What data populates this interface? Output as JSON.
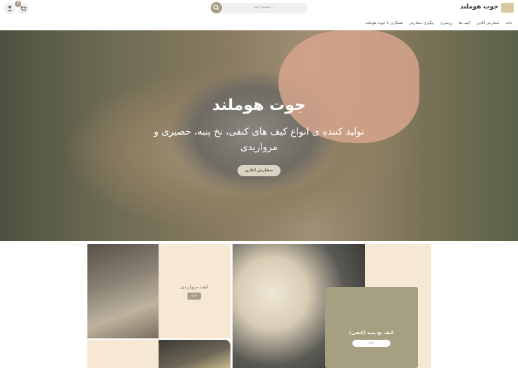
{
  "header": {
    "brand": "جوت هوملند",
    "search_placeholder": "جستجو کنید...",
    "cart_count": "0",
    "nav": [
      "خانه",
      "سفارش آنلاین",
      "کیف ها",
      "روسری",
      "پیگیری سفارش",
      "همکاری با جوت هوملند"
    ]
  },
  "hero": {
    "title": "جوت هوملند",
    "subtitle": "تولید کننده ی انواع کیف های کنفی، نخ پنبه، حصیری و مرواریدی",
    "button": "سفارش آنلاین"
  },
  "products": [
    {
      "label": "کیف مرواریدی",
      "button": "خرید"
    },
    {
      "label": "کیف نخ پنبه (کنفی)",
      "button": "خرید"
    }
  ]
}
